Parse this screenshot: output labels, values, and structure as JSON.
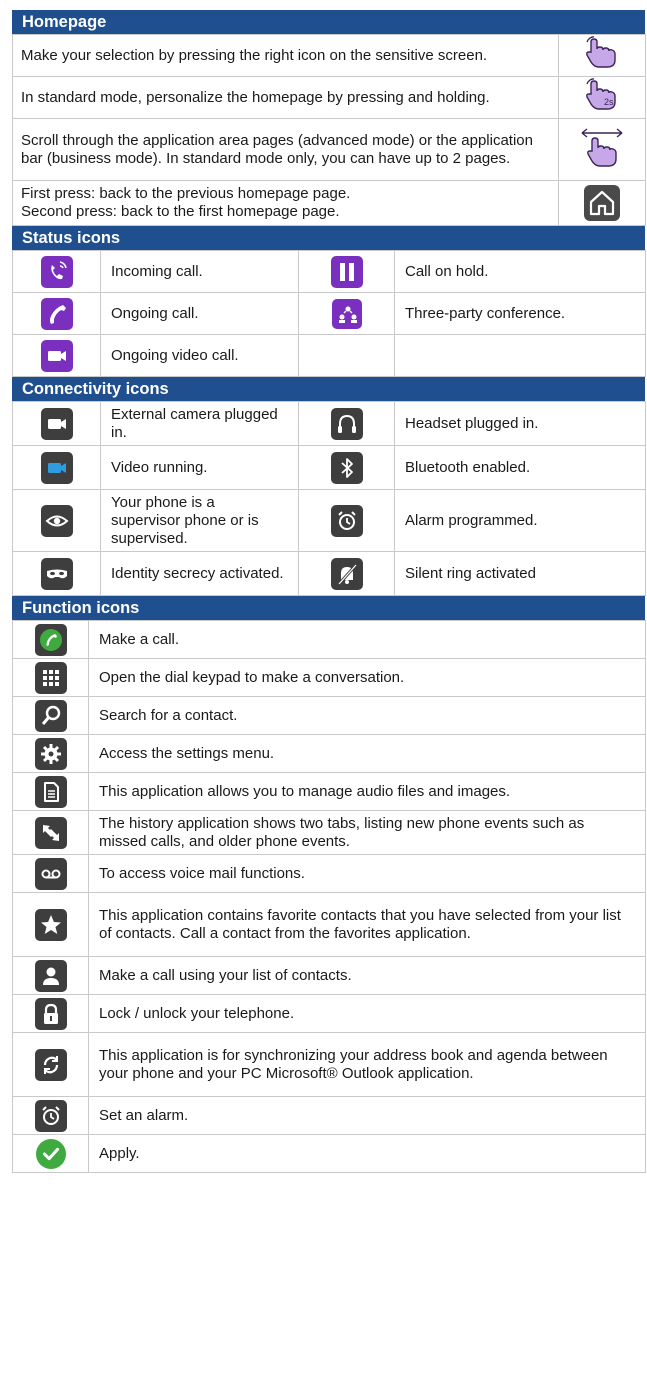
{
  "homepage": {
    "title": "Homepage",
    "rows": [
      {
        "text": "Make your selection by pressing the right icon on the sensitive screen.",
        "icon": "tap-hand-icon"
      },
      {
        "text": "In standard mode, personalize the homepage by pressing and holding.",
        "icon": "press-hold-2s-icon",
        "icon_label": "2s"
      },
      {
        "text": "Scroll through the application area pages (advanced mode) or the application bar (business mode). In standard mode only, you can have up to 2 pages.",
        "icon": "swipe-hand-icon"
      },
      {
        "text": "First press: back to the previous homepage page.\nSecond press: back to the first homepage page.",
        "icon": "home-icon"
      }
    ]
  },
  "status": {
    "title": "Status icons",
    "rows": [
      [
        {
          "text": "Incoming call.",
          "icon": "incoming-call-icon"
        },
        {
          "text": "Call on hold.",
          "icon": "pause-icon"
        }
      ],
      [
        {
          "text": "Ongoing call.",
          "icon": "phone-handset-icon"
        },
        {
          "text": "Three-party conference.",
          "icon": "conference-icon"
        }
      ],
      [
        {
          "text": "Ongoing video call.",
          "icon": "video-camera-icon"
        },
        {
          "text": "",
          "icon": ""
        }
      ]
    ]
  },
  "connectivity": {
    "title": "Connectivity icons",
    "rows": [
      [
        {
          "text": "External camera plugged in.",
          "icon": "camera-icon"
        },
        {
          "text": "Headset plugged in.",
          "icon": "headset-icon"
        }
      ],
      [
        {
          "text": "Video running.",
          "icon": "video-running-icon"
        },
        {
          "text": "Bluetooth enabled.",
          "icon": "bluetooth-icon"
        }
      ],
      [
        {
          "text": "Your phone is a supervisor phone or is supervised.",
          "icon": "eye-icon"
        },
        {
          "text": "Alarm programmed.",
          "icon": "alarm-icon"
        }
      ],
      [
        {
          "text": "Identity secrecy activated.",
          "icon": "mask-icon"
        },
        {
          "text": "Silent ring activated",
          "icon": "silent-bell-icon"
        }
      ]
    ]
  },
  "function": {
    "title": "Function icons",
    "rows": [
      {
        "text": "Make a call.",
        "icon": "green-phone-icon"
      },
      {
        "text": "Open the dial keypad to make a conversation.",
        "icon": "keypad-icon"
      },
      {
        "text": "Search for a contact.",
        "icon": "search-icon"
      },
      {
        "text": "Access the settings menu.",
        "icon": "gear-icon"
      },
      {
        "text": "This application allows you to manage audio files and images.",
        "icon": "document-icon"
      },
      {
        "text": "The history application shows two tabs, listing new phone events such as missed calls, and older phone events.",
        "icon": "history-arrows-icon"
      },
      {
        "text": "To access voice mail functions.",
        "icon": "voicemail-icon"
      },
      {
        "text": "This application contains favorite contacts that you have selected from your list of contacts. Call a contact from the favorites application.",
        "icon": "star-icon"
      },
      {
        "text": "Make a call using your list of contacts.",
        "icon": "contact-icon"
      },
      {
        "text": "Lock / unlock your telephone.",
        "icon": "lock-icon"
      },
      {
        "text": "This application is for synchronizing your address book and agenda between your phone and your PC Microsoft® Outlook application.",
        "icon": "sync-icon"
      },
      {
        "text": "Set an alarm.",
        "icon": "alarm-clock-icon"
      },
      {
        "text": "Apply.",
        "icon": "check-icon"
      }
    ]
  },
  "colors": {
    "header_bg": "#1F4F8F",
    "purple": "#7B2FBE",
    "dark_icon": "#3E3E3E",
    "green": "#3FAA3F",
    "hand_fill": "#C6A8E8"
  }
}
